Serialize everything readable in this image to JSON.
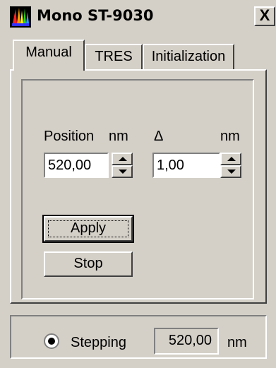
{
  "window": {
    "title": "Mono ST-9030",
    "close_label": "X"
  },
  "tabs": [
    {
      "label": "Manual",
      "active": true
    },
    {
      "label": "TRES",
      "active": false
    },
    {
      "label": "Initialization",
      "active": false
    }
  ],
  "manual": {
    "position_label": "Position",
    "position_unit": "nm",
    "position_value": "520,00",
    "delta_label": "Δ",
    "delta_unit": "nm",
    "delta_value": "1,00",
    "apply_label": "Apply",
    "stop_label": "Stop"
  },
  "status": {
    "mode_label": "Stepping",
    "current_value": "520,00",
    "unit": "nm"
  },
  "colors": {
    "face": "#d4d0c8",
    "shadow": "#404040",
    "highlight": "#ffffff"
  },
  "icons": {
    "app": "spectrum-icon",
    "close": "close-icon",
    "spin_up": "triangle-up-icon",
    "spin_down": "triangle-down-icon"
  }
}
